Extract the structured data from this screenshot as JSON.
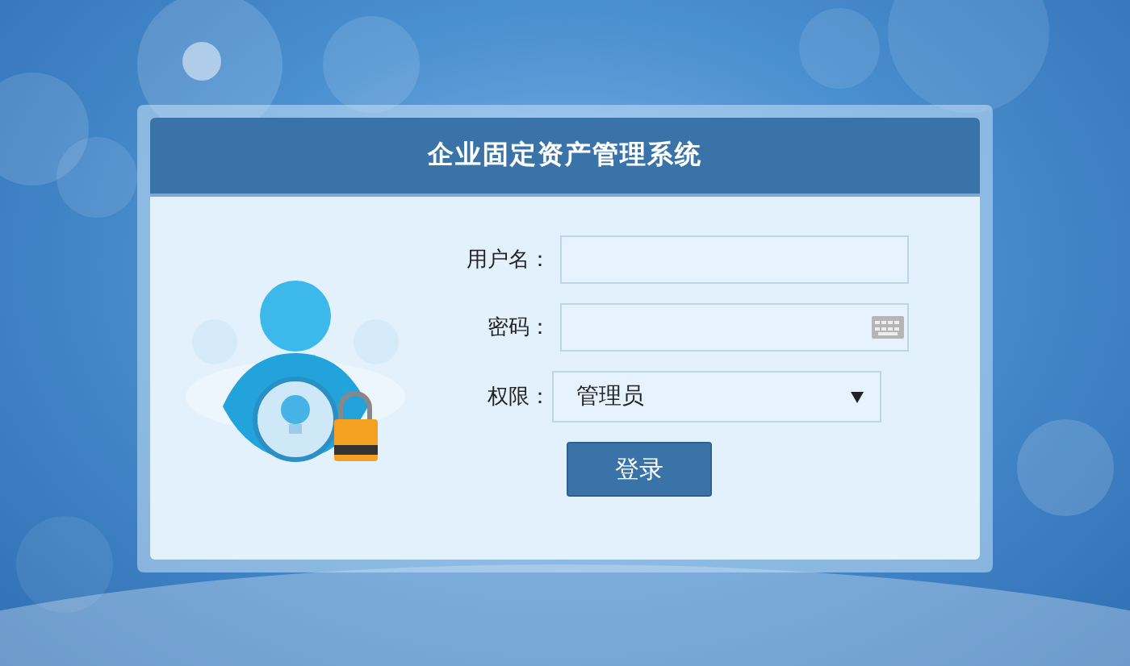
{
  "window": {
    "title": "企业固定资产管理系统"
  },
  "form": {
    "fields": [
      {
        "kind": "text",
        "label": "用户名："
      },
      {
        "kind": "password",
        "label": "密码："
      },
      {
        "kind": "select",
        "label": "权限：",
        "value": "管理员"
      }
    ],
    "button": "登录"
  }
}
